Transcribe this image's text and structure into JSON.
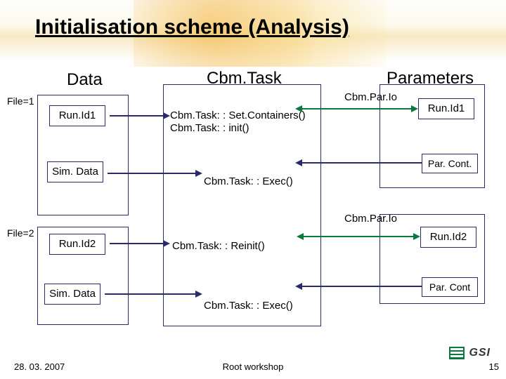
{
  "title": "Initialisation scheme (Analysis)",
  "columns": {
    "data": "Data",
    "task": "Cbm.Task",
    "params": "Parameters"
  },
  "files": {
    "f1": "File=1",
    "f2": "File=2"
  },
  "boxes": {
    "run1_left": "Run.Id1",
    "run1_right": "Run.Id1",
    "run2_left": "Run.Id2",
    "run2_right": "Run.Id2",
    "sim": "Sim. Data",
    "parcont": "Par. Cont.",
    "parcont2": "Par. Cont"
  },
  "task": {
    "set_init": "Cbm.Task: : Set.Containers()\nCbm.Task: : init()",
    "exec": "Cbm.Task: : Exec()",
    "reinit": "Cbm.Task: : Reinit()"
  },
  "pario": "Cbm.Par.Io",
  "footer": {
    "date": "28. 03. 2007",
    "center": "Root workshop",
    "slide": "15",
    "logo_text": "GSI"
  }
}
